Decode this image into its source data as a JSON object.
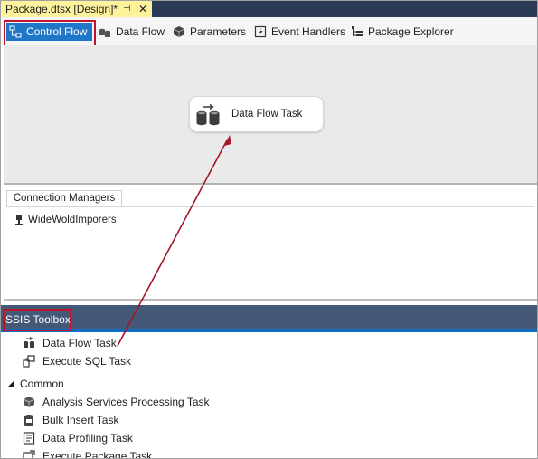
{
  "document_tab": {
    "title": "Package.dtsx [Design]*",
    "pin_glyph": "⊣",
    "close_glyph": "✕"
  },
  "designer_tabs": [
    {
      "label": "Control Flow",
      "icon": "control-flow-icon",
      "active": true
    },
    {
      "label": "Data Flow",
      "icon": "data-flow-icon",
      "active": false
    },
    {
      "label": "Parameters",
      "icon": "parameters-icon",
      "active": false
    },
    {
      "label": "Event Handlers",
      "icon": "event-handlers-icon",
      "active": false
    },
    {
      "label": "Package Explorer",
      "icon": "package-explorer-icon",
      "active": false
    }
  ],
  "canvas": {
    "task": {
      "label": "Data Flow Task",
      "icon": "data-flow-task-icon"
    }
  },
  "connection_managers": {
    "tab_label": "Connection Managers",
    "items": [
      {
        "label": "WideWoldImporers",
        "icon": "connection-plug-icon"
      }
    ]
  },
  "toolbox": {
    "title": "SSIS Toolbox",
    "favorites": [
      {
        "label": "Data Flow Task",
        "icon": "data-flow-task-icon"
      },
      {
        "label": "Execute SQL Task",
        "icon": "execute-sql-icon"
      }
    ],
    "common_group": {
      "label": "Common",
      "items": [
        {
          "label": "Analysis Services Processing Task",
          "icon": "cube-icon"
        },
        {
          "label": "Bulk Insert Task",
          "icon": "bulk-insert-icon"
        },
        {
          "label": "Data Profiling Task",
          "icon": "data-profiling-icon"
        },
        {
          "label": "Execute Package Task",
          "icon": "execute-package-icon"
        }
      ]
    }
  },
  "colors": {
    "tab_strip": "#2b3a57",
    "active_doc_tab": "#fff29d",
    "active_designer_tab": "#1f77c8",
    "toolbox_header": "#445977",
    "annotation_red": "#c0142e"
  }
}
